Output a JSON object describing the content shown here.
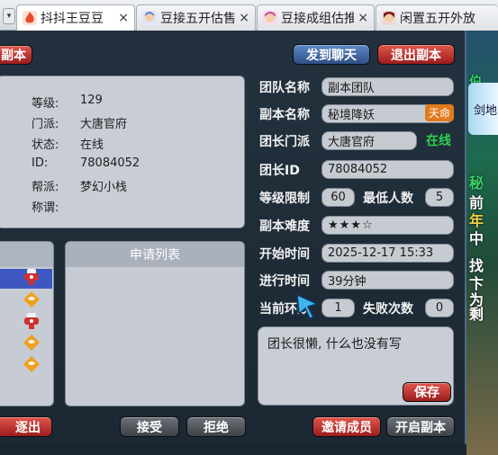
{
  "browser": {
    "tabs": [
      {
        "title": "抖抖王豆豆",
        "active": true,
        "icon": "flame-icon",
        "icon_color": "#e84a2a"
      },
      {
        "title": "豆接五开估售",
        "active": false,
        "icon": "character-icon",
        "icon_color": "#4a7bd8"
      },
      {
        "title": "豆接成组估推",
        "active": false,
        "icon": "character-icon",
        "icon_color": "#c0469a"
      },
      {
        "title": "闲置五开外放",
        "active": false,
        "icon": "character-icon",
        "icon_color": "#9a2a2a"
      }
    ],
    "close_glyph": "×"
  },
  "dialog": {
    "title_fragment": "副本",
    "send_chat_label": "发到聊天",
    "exit_dungeon_label": "退出副本",
    "player": {
      "level_label": "等级:",
      "level": "129",
      "faction_label": "门派:",
      "faction": "大唐官府",
      "status_label": "状态:",
      "status": "在线",
      "id_label": "ID:",
      "id": "78084052",
      "guild_label": "帮派:",
      "guild": "梦幻小栈",
      "title_label": "称谓:",
      "title": ""
    },
    "apply_list_header": "申请列表",
    "fields": {
      "team_name_label": "团队名称",
      "team_name": "副本团队",
      "dungeon_name_label": "副本名称",
      "dungeon_name": "秘境降妖",
      "dungeon_badge": "天命",
      "leader_faction_label": "团长门派",
      "leader_faction": "大唐官府",
      "leader_status": "在线",
      "leader_id_label": "团长ID",
      "leader_id": "78084052",
      "level_limit_label": "等级限制",
      "level_limit": "60",
      "min_people_label": "最低人数",
      "min_people": "5",
      "difficulty_label": "副本难度",
      "difficulty": "★★★☆",
      "start_time_label": "开始时间",
      "start_time": "2025-12-17 15:33",
      "duration_label": "进行时间",
      "duration": "39分钟",
      "current_ring_label": "当前环数",
      "current_ring": "1",
      "fail_count_label": "失败次数",
      "fail_count": "0"
    },
    "message": "团长很懒, 什么也没有写",
    "save_label": "保存",
    "kick_label": "逐出",
    "accept_label": "接受",
    "reject_label": "拒绝",
    "invite_label": "邀请成员",
    "start_dungeon_label": "开启副本"
  },
  "game_side": {
    "top_text": "伯",
    "scroll_text": "剑地",
    "lines": [
      "秘",
      "前",
      "年",
      "中",
      "找",
      "卞",
      "为",
      "剩"
    ]
  },
  "colors": {
    "blue_button": "#3f64a6",
    "red_button": "#b62a26",
    "dark_button": "#50565d",
    "online_green": "#2fd050",
    "badge_orange": "#e07a1c",
    "list_selected": "#3c58c0"
  }
}
